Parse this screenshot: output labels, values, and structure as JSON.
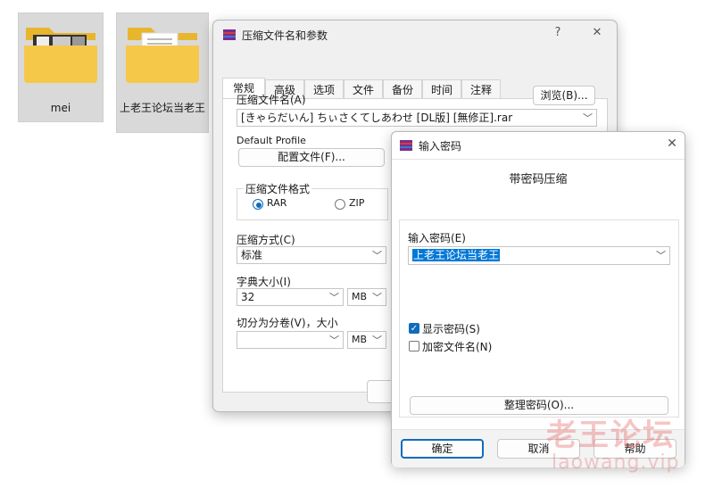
{
  "desktop": {
    "folders": [
      {
        "label": "mei"
      },
      {
        "label": "上老王论坛当老王"
      }
    ]
  },
  "archive_dialog": {
    "title": "压缩文件名和参数",
    "help_glyph": "?",
    "close_glyph": "✕",
    "tabs": [
      "常规",
      "高级",
      "选项",
      "文件",
      "备份",
      "时间",
      "注释"
    ],
    "archive_name_label": "压缩文件名(A)",
    "browse_label": "浏览(B)...",
    "archive_name_value": "[きゃらだいん] ちぃさくてしあわせ [DL版] [無修正].rar",
    "default_profile_label": "Default Profile",
    "profiles_button": "配置文件(F)...",
    "format_group_label": "压缩文件格式",
    "format_rar": "RAR",
    "format_zip": "ZIP",
    "method_label": "压缩方式(C)",
    "method_value": "标准",
    "dict_label": "字典大小(I)",
    "dict_value": "32",
    "dict_unit": "MB",
    "split_label": "切分为分卷(V)，大小",
    "split_value": "",
    "split_unit": "MB"
  },
  "password_dialog": {
    "title": "输入密码",
    "close_glyph": "✕",
    "heading": "带密码压缩",
    "enter_label": "输入密码(E)",
    "password_value": "上老王论坛当老王",
    "show_password_label": "显示密码(S)",
    "show_password_checked": true,
    "encrypt_names_label": "加密文件名(N)",
    "encrypt_names_checked": false,
    "organize_button": "整理密码(O)...",
    "ok_button": "确定",
    "cancel_button": "取消",
    "help_button": "帮助"
  },
  "watermark": {
    "line1": "老王论坛",
    "line2": "laowang.vip"
  },
  "colors": {
    "accent": "#0f6cbd",
    "selection": "#0078d7",
    "folder": "#f4c542"
  }
}
